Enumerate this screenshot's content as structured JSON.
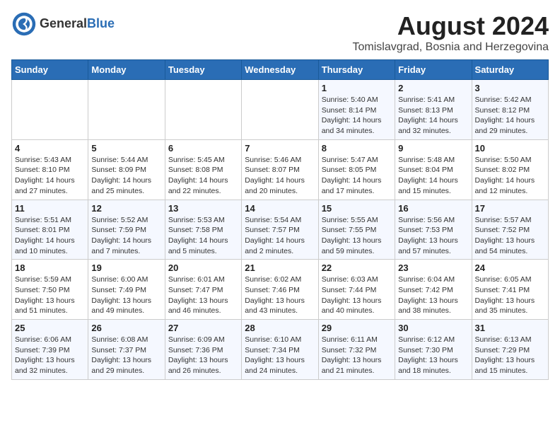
{
  "header": {
    "logo_general": "General",
    "logo_blue": "Blue",
    "month_year": "August 2024",
    "location": "Tomislavgrad, Bosnia and Herzegovina"
  },
  "weekdays": [
    "Sunday",
    "Monday",
    "Tuesday",
    "Wednesday",
    "Thursday",
    "Friday",
    "Saturday"
  ],
  "weeks": [
    [
      {
        "day": "",
        "info": ""
      },
      {
        "day": "",
        "info": ""
      },
      {
        "day": "",
        "info": ""
      },
      {
        "day": "",
        "info": ""
      },
      {
        "day": "1",
        "info": "Sunrise: 5:40 AM\nSunset: 8:14 PM\nDaylight: 14 hours\nand 34 minutes."
      },
      {
        "day": "2",
        "info": "Sunrise: 5:41 AM\nSunset: 8:13 PM\nDaylight: 14 hours\nand 32 minutes."
      },
      {
        "day": "3",
        "info": "Sunrise: 5:42 AM\nSunset: 8:12 PM\nDaylight: 14 hours\nand 29 minutes."
      }
    ],
    [
      {
        "day": "4",
        "info": "Sunrise: 5:43 AM\nSunset: 8:10 PM\nDaylight: 14 hours\nand 27 minutes."
      },
      {
        "day": "5",
        "info": "Sunrise: 5:44 AM\nSunset: 8:09 PM\nDaylight: 14 hours\nand 25 minutes."
      },
      {
        "day": "6",
        "info": "Sunrise: 5:45 AM\nSunset: 8:08 PM\nDaylight: 14 hours\nand 22 minutes."
      },
      {
        "day": "7",
        "info": "Sunrise: 5:46 AM\nSunset: 8:07 PM\nDaylight: 14 hours\nand 20 minutes."
      },
      {
        "day": "8",
        "info": "Sunrise: 5:47 AM\nSunset: 8:05 PM\nDaylight: 14 hours\nand 17 minutes."
      },
      {
        "day": "9",
        "info": "Sunrise: 5:48 AM\nSunset: 8:04 PM\nDaylight: 14 hours\nand 15 minutes."
      },
      {
        "day": "10",
        "info": "Sunrise: 5:50 AM\nSunset: 8:02 PM\nDaylight: 14 hours\nand 12 minutes."
      }
    ],
    [
      {
        "day": "11",
        "info": "Sunrise: 5:51 AM\nSunset: 8:01 PM\nDaylight: 14 hours\nand 10 minutes."
      },
      {
        "day": "12",
        "info": "Sunrise: 5:52 AM\nSunset: 7:59 PM\nDaylight: 14 hours\nand 7 minutes."
      },
      {
        "day": "13",
        "info": "Sunrise: 5:53 AM\nSunset: 7:58 PM\nDaylight: 14 hours\nand 5 minutes."
      },
      {
        "day": "14",
        "info": "Sunrise: 5:54 AM\nSunset: 7:57 PM\nDaylight: 14 hours\nand 2 minutes."
      },
      {
        "day": "15",
        "info": "Sunrise: 5:55 AM\nSunset: 7:55 PM\nDaylight: 13 hours\nand 59 minutes."
      },
      {
        "day": "16",
        "info": "Sunrise: 5:56 AM\nSunset: 7:53 PM\nDaylight: 13 hours\nand 57 minutes."
      },
      {
        "day": "17",
        "info": "Sunrise: 5:57 AM\nSunset: 7:52 PM\nDaylight: 13 hours\nand 54 minutes."
      }
    ],
    [
      {
        "day": "18",
        "info": "Sunrise: 5:59 AM\nSunset: 7:50 PM\nDaylight: 13 hours\nand 51 minutes."
      },
      {
        "day": "19",
        "info": "Sunrise: 6:00 AM\nSunset: 7:49 PM\nDaylight: 13 hours\nand 49 minutes."
      },
      {
        "day": "20",
        "info": "Sunrise: 6:01 AM\nSunset: 7:47 PM\nDaylight: 13 hours\nand 46 minutes."
      },
      {
        "day": "21",
        "info": "Sunrise: 6:02 AM\nSunset: 7:46 PM\nDaylight: 13 hours\nand 43 minutes."
      },
      {
        "day": "22",
        "info": "Sunrise: 6:03 AM\nSunset: 7:44 PM\nDaylight: 13 hours\nand 40 minutes."
      },
      {
        "day": "23",
        "info": "Sunrise: 6:04 AM\nSunset: 7:42 PM\nDaylight: 13 hours\nand 38 minutes."
      },
      {
        "day": "24",
        "info": "Sunrise: 6:05 AM\nSunset: 7:41 PM\nDaylight: 13 hours\nand 35 minutes."
      }
    ],
    [
      {
        "day": "25",
        "info": "Sunrise: 6:06 AM\nSunset: 7:39 PM\nDaylight: 13 hours\nand 32 minutes."
      },
      {
        "day": "26",
        "info": "Sunrise: 6:08 AM\nSunset: 7:37 PM\nDaylight: 13 hours\nand 29 minutes."
      },
      {
        "day": "27",
        "info": "Sunrise: 6:09 AM\nSunset: 7:36 PM\nDaylight: 13 hours\nand 26 minutes."
      },
      {
        "day": "28",
        "info": "Sunrise: 6:10 AM\nSunset: 7:34 PM\nDaylight: 13 hours\nand 24 minutes."
      },
      {
        "day": "29",
        "info": "Sunrise: 6:11 AM\nSunset: 7:32 PM\nDaylight: 13 hours\nand 21 minutes."
      },
      {
        "day": "30",
        "info": "Sunrise: 6:12 AM\nSunset: 7:30 PM\nDaylight: 13 hours\nand 18 minutes."
      },
      {
        "day": "31",
        "info": "Sunrise: 6:13 AM\nSunset: 7:29 PM\nDaylight: 13 hours\nand 15 minutes."
      }
    ]
  ]
}
